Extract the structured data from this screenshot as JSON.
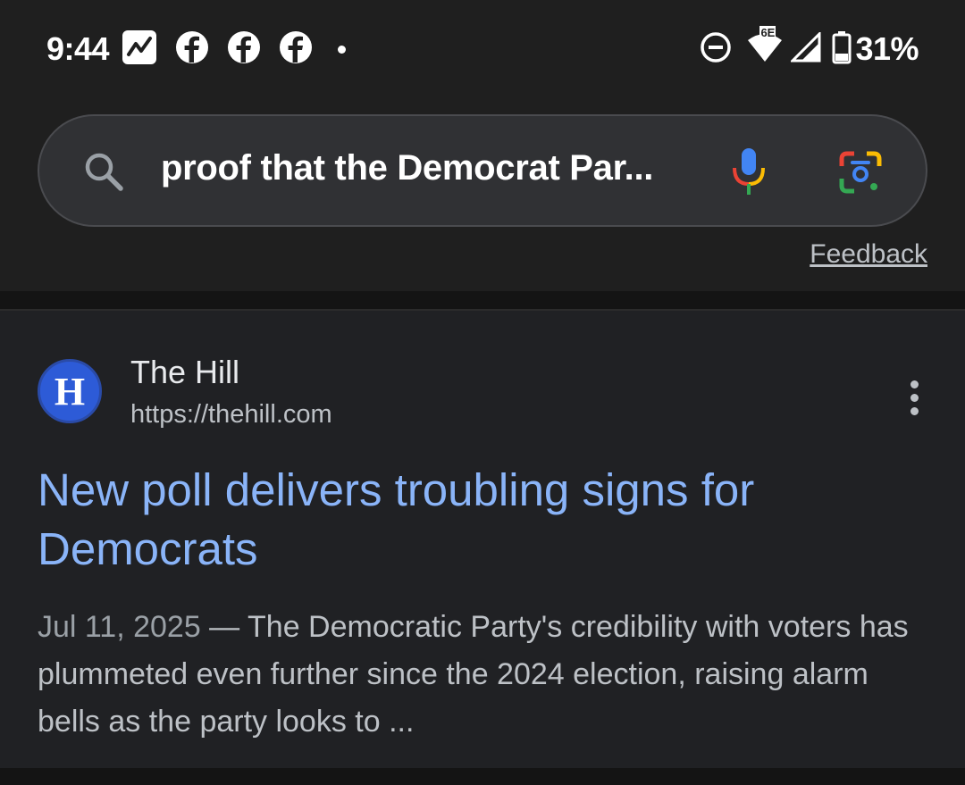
{
  "status_bar": {
    "time": "9:44",
    "notification_icons": [
      "trending-icon",
      "facebook-icon",
      "facebook-icon",
      "facebook-icon",
      "dot-icon"
    ],
    "system_icons": [
      "do-not-disturb-icon",
      "wifi-icon",
      "cell-signal-icon",
      "battery-icon"
    ],
    "wifi_label": "6E",
    "battery_percent": "31%"
  },
  "search": {
    "query": "proof that the Democrat Par..."
  },
  "feedback_label": "Feedback",
  "result": {
    "site_logo_letter": "H",
    "site_name": "The Hill",
    "site_url": "https://thehill.com",
    "title": "New poll delivers troubling signs for Democrats",
    "date": "Jul 11, 2025",
    "separator": " — ",
    "snippet": "The Democratic Party's credibility with voters has plummeted even further since the 2024 election, raising alarm bells as the party looks to ..."
  },
  "colors": {
    "background": "#1f1f1f",
    "card": "#202124",
    "link": "#8ab4f8",
    "search_bar": "#303134",
    "logo": "#2d5bd7"
  }
}
